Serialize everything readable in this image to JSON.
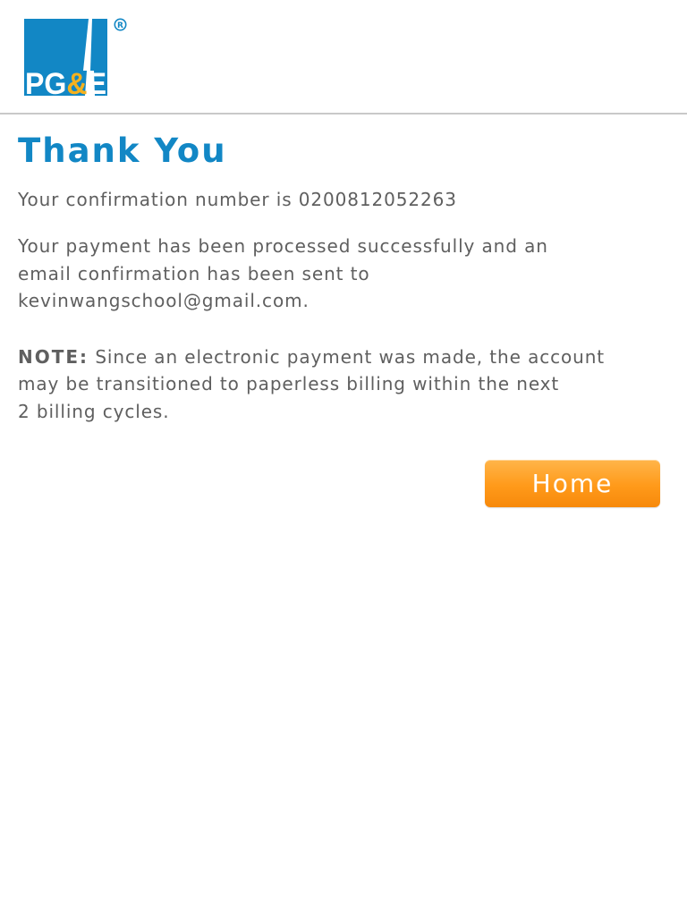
{
  "brand": {
    "logo_text": "PG&E",
    "registered_mark": "®",
    "logo_colors": {
      "blue": "#1287c5",
      "yellow": "#f5b11e",
      "white": "#ffffff"
    }
  },
  "main": {
    "title": "Thank You",
    "confirmation_label": "Your confirmation number is",
    "confirmation_number": "0200812052263",
    "message_line1": "Your payment has been processed successfully and an",
    "message_line2": "email confirmation has been sent to",
    "email": "kevinwangschool@gmail.com",
    "email_suffix": ".",
    "note_label": "NOTE:",
    "note_line1": "Since an electronic payment was made, the account",
    "note_line2": "may be transitioned to paperless billing within the next",
    "note_line3": "2 billing cycles."
  },
  "actions": {
    "home_label": "Home"
  },
  "colors": {
    "accent_blue": "#1287c5",
    "body_text": "#5f5f5f",
    "button_orange": "#ff9a1a",
    "divider": "#c9c9c9"
  }
}
